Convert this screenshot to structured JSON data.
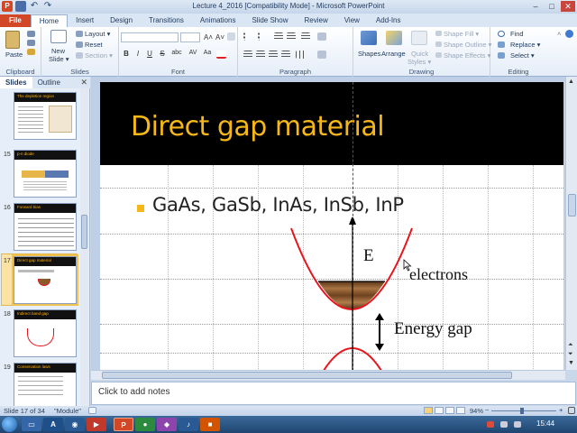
{
  "window": {
    "title": "Lecture 4_2016 [Compatibility Mode]  -  Microsoft PowerPoint",
    "app_icon": "P",
    "controls": [
      "–",
      "□",
      "✕"
    ]
  },
  "ribbon": {
    "tabs": [
      "File",
      "Home",
      "Insert",
      "Design",
      "Transitions",
      "Animations",
      "Slide Show",
      "Review",
      "View",
      "Add-Ins"
    ],
    "active_tab": "Home",
    "clipboard": {
      "label": "Clipboard",
      "paste": "Paste"
    },
    "slides": {
      "label": "Slides",
      "new_slide_1": "New",
      "new_slide_2": "Slide ▾",
      "layout": "Layout ▾",
      "reset": "Reset",
      "section": "Section ▾"
    },
    "font": {
      "label": "Font",
      "bold": "B",
      "italic": "I",
      "underline": "U",
      "strike": "S",
      "shadow": "abc",
      "spacing": "AV",
      "case": "Aa",
      "grow": "A˄",
      "shrink": "A˅"
    },
    "paragraph": {
      "label": "Paragraph"
    },
    "drawing": {
      "label": "Drawing",
      "shapes": "Shapes",
      "arrange": "Arrange",
      "quick_styles_1": "Quick",
      "quick_styles_2": "Styles ▾",
      "shape_fill": "Shape Fill ▾",
      "shape_outline": "Shape Outline ▾",
      "shape_effects": "Shape Effects ▾"
    },
    "editing": {
      "label": "Editing",
      "find": "Find",
      "replace": "Replace ▾",
      "select": "Select ▾"
    }
  },
  "pane": {
    "tab_slides": "Slides",
    "tab_outline": "Outline",
    "close": "✕",
    "thumbnails": [
      {
        "num": "",
        "title": "The depletion region"
      },
      {
        "num": "15",
        "title": "p-n diode"
      },
      {
        "num": "16",
        "title": "Forward bias"
      },
      {
        "num": "17",
        "title": "Direct gap material"
      },
      {
        "num": "18",
        "title": "Indirect band gap"
      },
      {
        "num": "19",
        "title": "Conservation laws"
      }
    ]
  },
  "slide": {
    "title": "Direct gap material",
    "bullet": "GaAs, GaSb, InAs, InSb,  InP",
    "label_E": "E",
    "label_electrons": "electrons",
    "label_gap": "Energy gap",
    "colors": {
      "title": "#f6b818",
      "curve": "#e8141b",
      "band": "#000000"
    }
  },
  "notes": {
    "placeholder": "Click to add notes"
  },
  "status": {
    "slide_info": "Slide 17 of 34",
    "theme": "\"Module\"",
    "zoom": "94%",
    "zoom_minus": "−",
    "zoom_plus": "+"
  },
  "taskbar": {
    "clock": "15:44"
  }
}
